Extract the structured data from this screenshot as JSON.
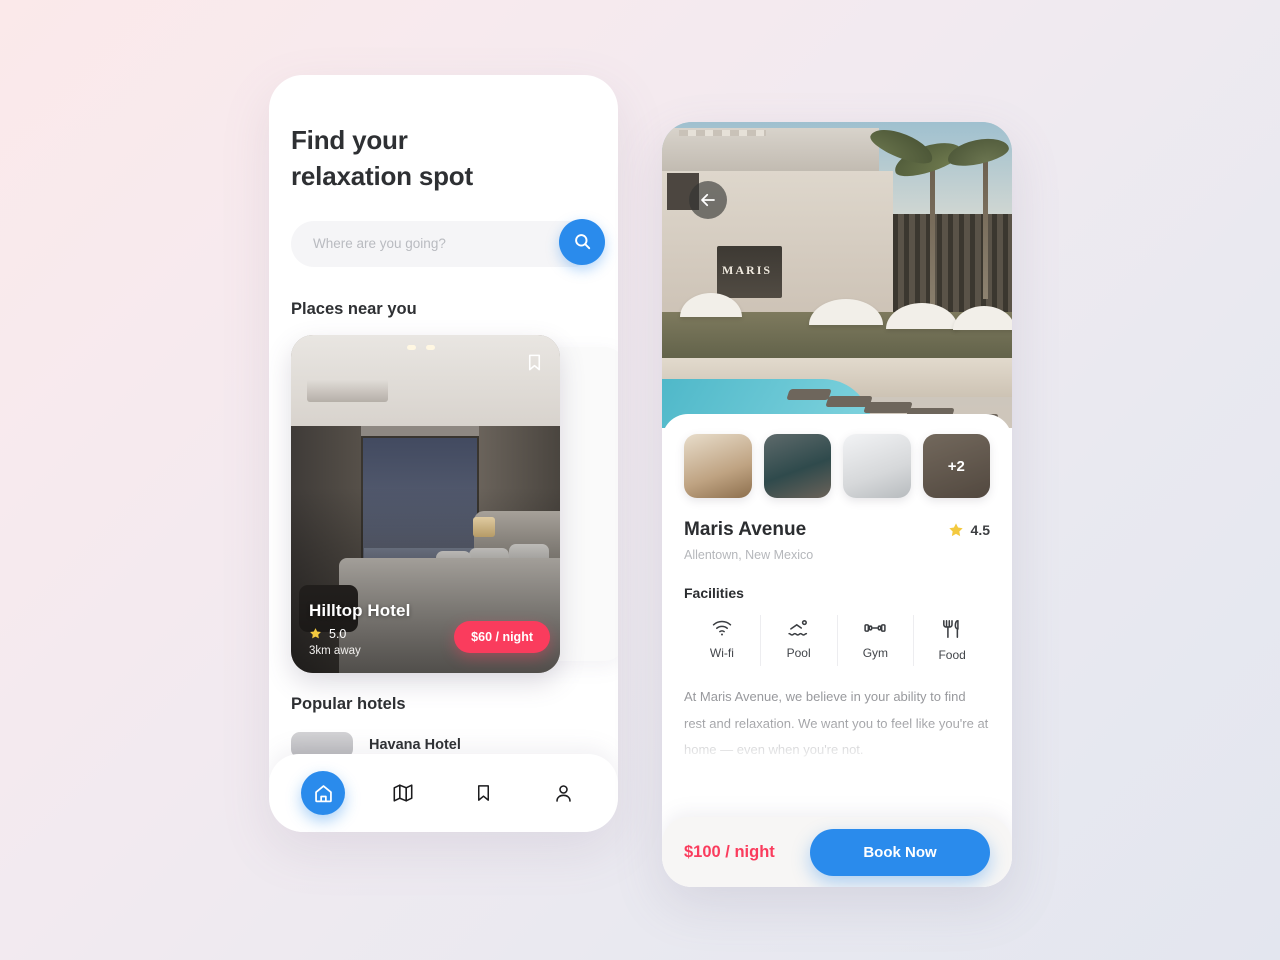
{
  "home": {
    "headline_line1": "Find your",
    "headline_line2": "relaxation spot",
    "search": {
      "placeholder": "Where are you going?",
      "value": "",
      "button_icon": "search-icon"
    },
    "section_nearby": "Places near you",
    "featured_card": {
      "name": "Hilltop Hotel",
      "rating": "5.0",
      "distance": "3km away",
      "price": "$60 / night",
      "bookmark_icon": "bookmark-icon",
      "star_icon": "star-icon"
    },
    "section_popular": "Popular hotels",
    "popular_items": [
      {
        "name": "Havana Hotel"
      }
    ],
    "tabs": [
      {
        "name": "home",
        "icon": "home-icon",
        "active": true
      },
      {
        "name": "map",
        "icon": "map-icon",
        "active": false
      },
      {
        "name": "saved",
        "icon": "bookmark-icon",
        "active": false
      },
      {
        "name": "profile",
        "icon": "person-icon",
        "active": false
      }
    ]
  },
  "detail": {
    "back_icon": "arrow-left-icon",
    "hero_sign_text": "MARIS",
    "gallery": [
      {
        "label": ""
      },
      {
        "label": ""
      },
      {
        "label": ""
      },
      {
        "label": "+2"
      }
    ],
    "title": "Maris Avenue",
    "rating": "4.5",
    "star_icon": "star-icon",
    "address": "Allentown, New Mexico",
    "facilities_title": "Facilities",
    "facilities": [
      {
        "label": "Wi-fi",
        "icon": "wifi-icon"
      },
      {
        "label": "Pool",
        "icon": "pool-icon"
      },
      {
        "label": "Gym",
        "icon": "dumbbell-icon"
      },
      {
        "label": "Food",
        "icon": "cutlery-icon"
      }
    ],
    "description": "At Maris Avenue, we believe in your ability to find rest and relaxation. We want you to feel like you're at home — even when you're not.",
    "price": "$100 / night",
    "book_label": "Book Now"
  },
  "colors": {
    "accent_blue": "#2a8bec",
    "accent_red": "#fa3c5d",
    "star_yellow": "#f3c93f",
    "bg_start": "#fbe9ea",
    "bg_end": "#e3e6ef"
  }
}
